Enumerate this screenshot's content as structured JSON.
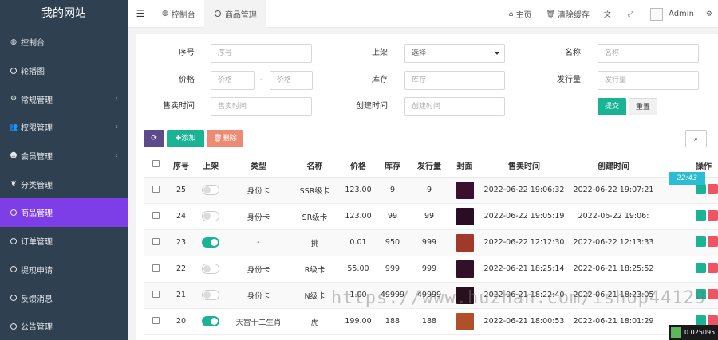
{
  "sidebar": {
    "brand": "我的网站",
    "items": [
      {
        "label": "控制台",
        "icon": "dashboard-icon",
        "glyph": "◍",
        "chevron": false,
        "active": false
      },
      {
        "label": "轮播图",
        "icon": "circle-icon",
        "glyph": "○",
        "chevron": false,
        "active": false
      },
      {
        "label": "常规管理",
        "icon": "cogs-icon",
        "glyph": "⚙",
        "chevron": true,
        "active": false
      },
      {
        "label": "权限管理",
        "icon": "users-icon",
        "glyph": "👥",
        "chevron": true,
        "active": false
      },
      {
        "label": "会员管理",
        "icon": "user-icon",
        "glyph": "☻",
        "chevron": true,
        "active": false
      },
      {
        "label": "分类管理",
        "icon": "leaf-icon",
        "glyph": "❦",
        "chevron": false,
        "active": false
      },
      {
        "label": "商品管理",
        "icon": "circle-icon",
        "glyph": "○",
        "chevron": false,
        "active": true
      },
      {
        "label": "订单管理",
        "icon": "circle-icon",
        "glyph": "○",
        "chevron": false,
        "active": false
      },
      {
        "label": "提现申请",
        "icon": "circle-icon",
        "glyph": "○",
        "chevron": false,
        "active": false
      },
      {
        "label": "反馈消息",
        "icon": "circle-icon",
        "glyph": "○",
        "chevron": false,
        "active": false
      },
      {
        "label": "公告管理",
        "icon": "circle-icon",
        "glyph": "○",
        "chevron": false,
        "active": false
      }
    ]
  },
  "topbar": {
    "tabs": [
      {
        "label": "控制台",
        "icon": "dashboard-icon"
      },
      {
        "label": "商品管理",
        "icon": "circle-icon"
      }
    ],
    "links": {
      "home": "主页",
      "clear_cache": "清除缓存",
      "admin": "Admin"
    }
  },
  "search_form": {
    "id_label": "序号",
    "id_placeholder": "序号",
    "shelf_label": "上架",
    "shelf_value": "选择",
    "name_label": "名称",
    "name_placeholder": "名称",
    "price_label": "价格",
    "price_min_placeholder": "价格",
    "price_sep": "-",
    "price_max_placeholder": "价格",
    "stock_label": "库存",
    "stock_placeholder": "库存",
    "issue_label": "发行量",
    "issue_placeholder": "发行量",
    "sale_time_label": "售卖时间",
    "sale_time_placeholder": "售卖时间",
    "create_time_label": "创建时间",
    "create_time_placeholder": "创建时间",
    "submit": "提交",
    "reset": "重置"
  },
  "toolbar": {
    "add": "添加",
    "delete": "删除"
  },
  "table": {
    "headers": [
      "序号",
      "上架",
      "类型",
      "名称",
      "价格",
      "库存",
      "发行量",
      "封面",
      "售卖时间",
      "创建时间",
      "操作"
    ],
    "rows": [
      {
        "id": "25",
        "on": false,
        "type": "身份卡",
        "name": "SSR级卡",
        "price": "123.00",
        "stock": "9",
        "issue": "9",
        "cover": "#3a1030",
        "sale": "2022-06-22 19:06:32",
        "created": "2022-06-22 19:07:21"
      },
      {
        "id": "24",
        "on": false,
        "type": "身份卡",
        "name": "SR级卡",
        "price": "123.00",
        "stock": "99",
        "issue": "99",
        "cover": "#2a0c25",
        "sale": "2022-06-22 19:05:19",
        "created": "2022-06-22 19:06:"
      },
      {
        "id": "23",
        "on": true,
        "type": "-",
        "name": "挑",
        "price": "0.01",
        "stock": "950",
        "issue": "999",
        "cover": "#a0392a",
        "sale": "2022-06-22 12:12:30",
        "created": "2022-06-22 12:13:33"
      },
      {
        "id": "22",
        "on": false,
        "type": "身份卡",
        "name": "R级卡",
        "price": "55.00",
        "stock": "999",
        "issue": "999",
        "cover": "#311028",
        "sale": "2022-06-21 18:25:14",
        "created": "2022-06-21 18:25:52"
      },
      {
        "id": "21",
        "on": false,
        "type": "身份卡",
        "name": "N级卡",
        "price": "1.00",
        "stock": "49999",
        "issue": "49999",
        "cover": "#28101f",
        "sale": "2022-06-21 18:22:40",
        "created": "2022-06-21 18:23:05"
      },
      {
        "id": "20",
        "on": true,
        "type": "天宫十二生肖",
        "name": "虎",
        "price": "199.00",
        "stock": "188",
        "issue": "188",
        "cover": "#b0502a",
        "sale": "2022-06-21 18:00:53",
        "created": "2022-06-21 18:01:29"
      }
    ]
  },
  "overlay": {
    "clock": "22:43",
    "speed": "0.025095",
    "watermark": "https://www.huzhan.com/ishop44129"
  }
}
